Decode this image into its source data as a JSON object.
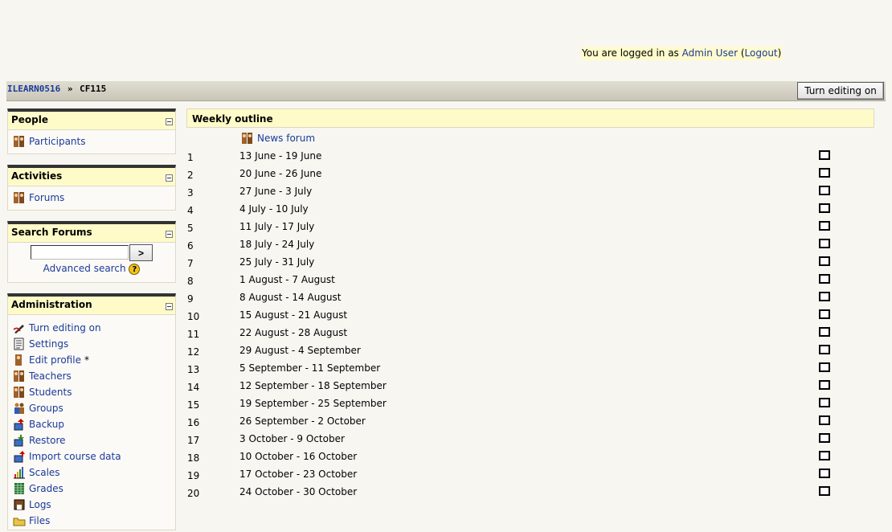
{
  "header": {
    "login_prefix": "You are logged in as ",
    "user_name": "Admin User",
    "logout_open": " (",
    "logout_label": "Logout",
    "logout_close": ")"
  },
  "navbar": {
    "breadcrumb_root": "ILEARN0516",
    "breadcrumb_sep": "»",
    "breadcrumb_current": "CF115",
    "edit_button": "Turn editing on"
  },
  "blocks": {
    "people": {
      "title": "People",
      "items": [
        {
          "label": "Participants",
          "icon": "people-icon"
        }
      ]
    },
    "activities": {
      "title": "Activities",
      "items": [
        {
          "label": "Forums",
          "icon": "forum-icon"
        }
      ]
    },
    "search": {
      "title": "Search Forums",
      "go_label": ">",
      "advanced_label": "Advanced search",
      "help": "?"
    },
    "admin": {
      "title": "Administration",
      "items": [
        {
          "label": "Turn editing on",
          "icon": "edit-icon"
        },
        {
          "label": "Settings",
          "icon": "settings-icon"
        },
        {
          "label": "Edit profile",
          "icon": "profile-icon"
        },
        {
          "label": "Teachers",
          "icon": "people-icon"
        },
        {
          "label": "Students",
          "icon": "people-icon"
        },
        {
          "label": "Groups",
          "icon": "groups-icon"
        },
        {
          "label": "Backup",
          "icon": "backup-icon"
        },
        {
          "label": "Restore",
          "icon": "restore-icon"
        },
        {
          "label": "Import course data",
          "icon": "import-icon"
        },
        {
          "label": "Scales",
          "icon": "scales-icon"
        },
        {
          "label": "Grades",
          "icon": "grades-icon"
        },
        {
          "label": "Logs",
          "icon": "logs-icon"
        },
        {
          "label": "Files",
          "icon": "folder-icon"
        }
      ],
      "edit_profile_star": "*"
    }
  },
  "main": {
    "title": "Weekly outline",
    "news_forum": "News forum",
    "weeks": [
      {
        "num": "1",
        "dates": "13 June - 19 June"
      },
      {
        "num": "2",
        "dates": "20 June - 26 June"
      },
      {
        "num": "3",
        "dates": "27 June - 3 July"
      },
      {
        "num": "4",
        "dates": "4 July - 10 July"
      },
      {
        "num": "5",
        "dates": "11 July - 17 July"
      },
      {
        "num": "6",
        "dates": "18 July - 24 July"
      },
      {
        "num": "7",
        "dates": "25 July - 31 July"
      },
      {
        "num": "8",
        "dates": "1 August - 7 August"
      },
      {
        "num": "9",
        "dates": "8 August - 14 August"
      },
      {
        "num": "10",
        "dates": "15 August - 21 August"
      },
      {
        "num": "11",
        "dates": "22 August - 28 August"
      },
      {
        "num": "12",
        "dates": "29 August - 4 September"
      },
      {
        "num": "13",
        "dates": "5 September - 11 September"
      },
      {
        "num": "14",
        "dates": "12 September - 18 September"
      },
      {
        "num": "15",
        "dates": "19 September - 25 September"
      },
      {
        "num": "16",
        "dates": "26 September - 2 October"
      },
      {
        "num": "17",
        "dates": "3 October - 9 October"
      },
      {
        "num": "18",
        "dates": "10 October - 16 October"
      },
      {
        "num": "19",
        "dates": "17 October - 23 October"
      },
      {
        "num": "20",
        "dates": "24 October - 30 October"
      }
    ]
  }
}
